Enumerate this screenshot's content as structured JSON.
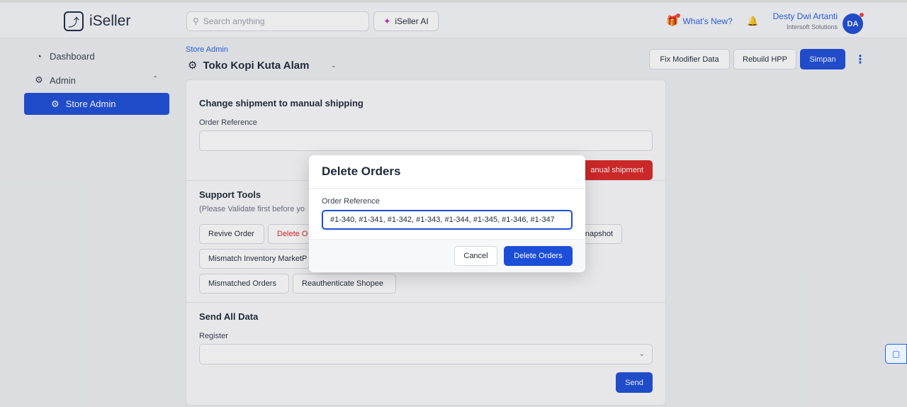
{
  "app": {
    "brand": "iSeller",
    "search_placeholder": "Search anything",
    "ai_label": "iSeller AI",
    "whats_new": "What's New?",
    "user_name": "Desty Dwi Artanti",
    "user_org": "Intersoft Solutions",
    "avatar_initials": "DA"
  },
  "sidebar": {
    "items": [
      {
        "label": "Dashboard",
        "icon": "dashboard-icon"
      },
      {
        "label": "Admin",
        "icon": "gear-icon"
      },
      {
        "label": "Store Admin",
        "icon": "gear-icon",
        "active": true
      }
    ]
  },
  "page": {
    "breadcrumb": "Store Admin",
    "store_name": "Toko Kopi Kuta Alam",
    "actions": {
      "fix_modifier": "Fix Modifier Data",
      "rebuild_hpp": "Rebuild HPP",
      "save": "Simpan"
    }
  },
  "manual_shipping": {
    "title": "Change shipment to manual shipping",
    "label": "Order Reference",
    "button_partial": "anual shipment"
  },
  "support_tools": {
    "title": "Support Tools",
    "hint_partial": "(Please Validate first before yo",
    "buttons": {
      "revive": "Revive Order",
      "delete_partial": "Delete O",
      "snapshot_partial": "napshot",
      "mismatch_partial": "Mismatch Inventory MarketP",
      "mismatched_orders": "Mismatched Orders",
      "reauth_shopee": "Reauthenticate Shopee"
    }
  },
  "send_all": {
    "title": "Send All Data",
    "label": "Register",
    "button": "Send"
  },
  "modal": {
    "title": "Delete Orders",
    "label": "Order Reference",
    "value": "#1-340, #1-341, #1-342, #1-343, #1-344, #1-345, #1-346, #1-347",
    "cancel": "Cancel",
    "confirm": "Delete Orders"
  },
  "colors": {
    "primary": "#1d4ed8",
    "danger": "#dc2626"
  }
}
